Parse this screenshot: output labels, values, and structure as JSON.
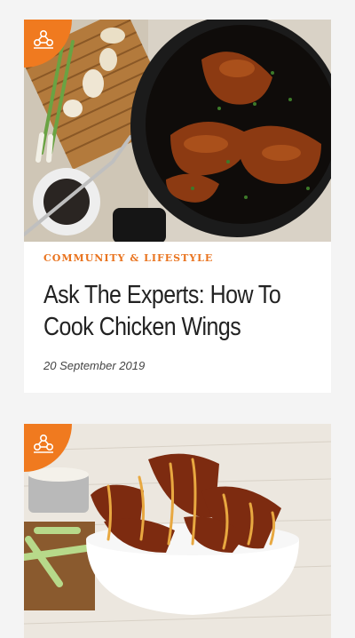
{
  "colors": {
    "accent": "#f07a1f",
    "category": "#e9731e",
    "background": "#f4f4f4",
    "card": "#ffffff"
  },
  "articles": [
    {
      "category": "Community & Lifestyle",
      "title": "Ask The Experts: How To Cook Chicken Wings",
      "date": "20 September 2019",
      "image": "pan-fried-chicken-wings-photo",
      "badge_icon": "brand-logo-icon"
    },
    {
      "image": "bbq-chicken-wings-bowl-photo",
      "badge_icon": "brand-logo-icon"
    }
  ]
}
